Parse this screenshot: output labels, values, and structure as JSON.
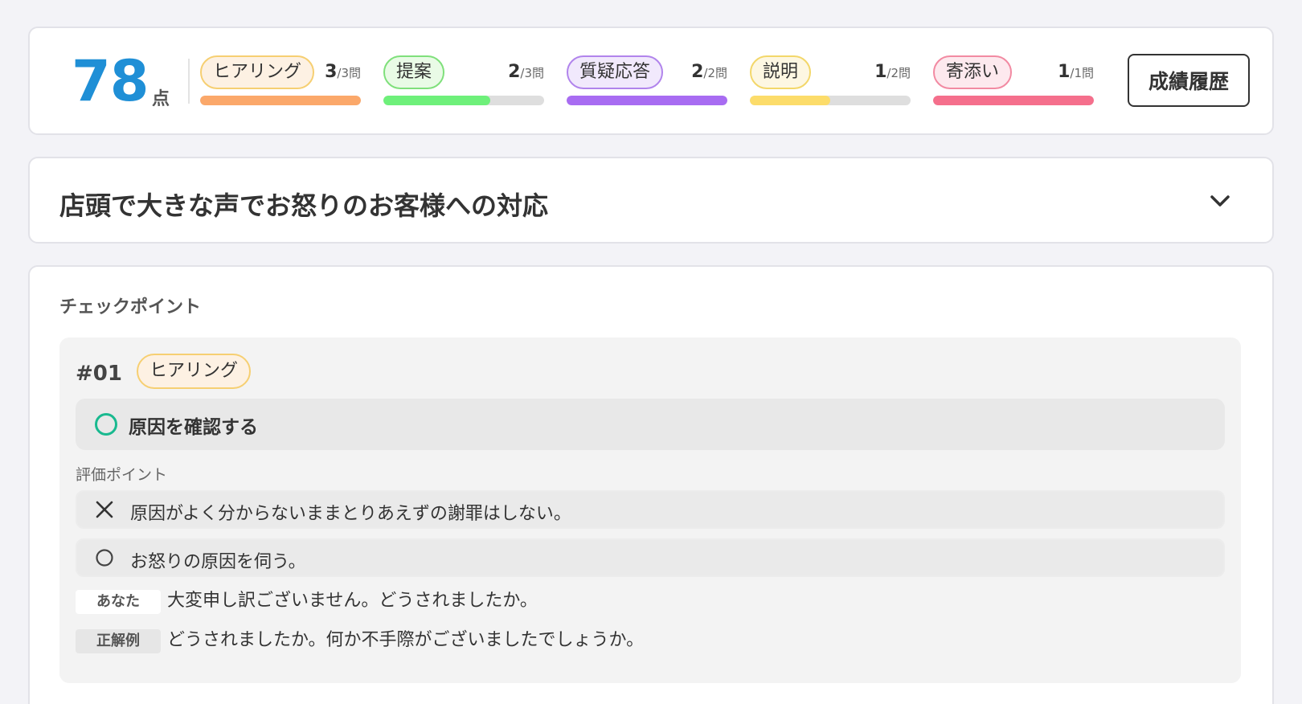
{
  "score": {
    "value": "78",
    "unit": "点"
  },
  "categories": [
    {
      "label": "ヒアリング",
      "correct": "3",
      "total_label": "/3問",
      "progress": 1.0,
      "color": "#fba86a",
      "pill_bg": "#fdf1e3",
      "pill_border": "#f6cf72"
    },
    {
      "label": "提案",
      "correct": "2",
      "total_label": "/3問",
      "progress": 0.667,
      "color": "#6ef07a",
      "pill_bg": "#e9fbe6",
      "pill_border": "#7fe07b"
    },
    {
      "label": "質疑応答",
      "correct": "2",
      "total_label": "/2問",
      "progress": 1.0,
      "color": "#a86cf2",
      "pill_bg": "#f1e9fc",
      "pill_border": "#b184ec"
    },
    {
      "label": "説明",
      "correct": "1",
      "total_label": "/2問",
      "progress": 0.5,
      "color": "#fcdc6a",
      "pill_bg": "#fdf7e2",
      "pill_border": "#f3d76a"
    },
    {
      "label": "寄添い",
      "correct": "1",
      "total_label": "/1問",
      "progress": 1.0,
      "color": "#f56f8c",
      "pill_bg": "#fde9ee",
      "pill_border": "#f28aa2"
    }
  ],
  "history_button": "成績履歴",
  "scenario": {
    "title": "店頭で大きな声でお怒りのお客様への対応",
    "toggle_icon": "chevron-down-icon"
  },
  "checkpoints": {
    "section_label": "チェックポイント",
    "items": [
      {
        "number": "#01",
        "category": "ヒアリング",
        "goal": "原因を確認する",
        "goal_status_icon": "circle-check-icon",
        "eval_label": "評価ポイント",
        "eval_points": [
          {
            "icon": "cross-icon",
            "text": "原因がよく分からないままとりあえずの謝罪はしない。"
          },
          {
            "icon": "circle-icon",
            "text": "お怒りの原因を伺う。"
          }
        ],
        "your_answer_label": "あなた",
        "your_answer": "大変申し訳ございません。どうされましたか。",
        "model_answer_label": "正解例",
        "model_answer": "どうされましたか。何か不手際がございましたでしょうか。"
      }
    ]
  }
}
